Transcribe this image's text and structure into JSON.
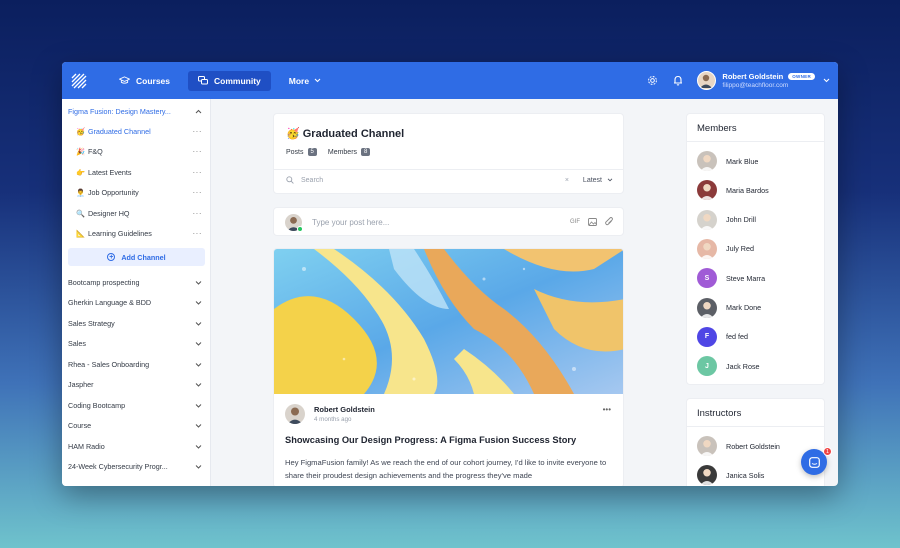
{
  "topbar": {
    "nav": [
      {
        "label": "Courses",
        "icon": "graduation-cap-icon"
      },
      {
        "label": "Community",
        "icon": "chat-bubbles-icon"
      },
      {
        "label": "More",
        "icon": "chevron-down-icon"
      }
    ],
    "user": {
      "name": "Robert Goldstein",
      "badge": "OWNER",
      "email": "filippo@teachfloor.com"
    },
    "accent": "#2f6ce5"
  },
  "sidebar": {
    "course": "Figma Fusion: Design Mastery...",
    "channels": [
      {
        "emoji": "🥳",
        "label": "Graduated Channel"
      },
      {
        "emoji": "🎉",
        "label": "F&Q"
      },
      {
        "emoji": "👉",
        "label": "Latest Events"
      },
      {
        "emoji": "👨‍💼",
        "label": "Job Opportunity"
      },
      {
        "emoji": "🔍",
        "label": "Designer HQ"
      },
      {
        "emoji": "📐",
        "label": "Learning Guidelines"
      }
    ],
    "add_channel": "Add Channel",
    "groups": [
      "Bootcamp prospecting",
      "Gherkin Language & BDD",
      "Sales Strategy",
      "Sales",
      "Rhea - Sales Onboarding",
      "Jaspher",
      "Coding Bootcamp",
      "Course",
      "HAM Radio",
      "24-Week Cybersecurity Progr..."
    ]
  },
  "channel": {
    "title": "🥳 Graduated Channel",
    "posts_label": "Posts",
    "posts_count": "5",
    "members_label": "Members",
    "members_count": "8",
    "search_placeholder": "Search",
    "sort": "Latest"
  },
  "composer": {
    "placeholder": "Type your post here..."
  },
  "post": {
    "author": "Robert Goldstein",
    "time": "4 months ago",
    "title": "Showcasing Our Design Progress: A Figma Fusion Success Story",
    "body": "Hey FigmaFusion family! As we reach the end of our cohort journey, I'd like to invite everyone to share their proudest design achievements and the progress they've made"
  },
  "members_panel": {
    "title": "Members",
    "members": [
      {
        "name": "Mark Blue",
        "initial": "",
        "color": "#c9c2bb"
      },
      {
        "name": "Maria Bardos",
        "initial": "",
        "color": "#8b3a3a"
      },
      {
        "name": "John Drill",
        "initial": "",
        "color": "#d5d2cc"
      },
      {
        "name": "July Red",
        "initial": "",
        "color": "#e6b8a6"
      },
      {
        "name": "Steve Marra",
        "initial": "S",
        "color": "#a05bd6"
      },
      {
        "name": "Mark Done",
        "initial": "",
        "color": "#5c5f66"
      },
      {
        "name": "fed fed",
        "initial": "F",
        "color": "#4f46e5"
      },
      {
        "name": "Jack Rose",
        "initial": "J",
        "color": "#6cc7a3"
      }
    ]
  },
  "instructors_panel": {
    "title": "Instructors",
    "members": [
      {
        "name": "Robert Goldstein",
        "color": "#c9c2bb"
      },
      {
        "name": "Janica Solis",
        "color": "#3a3a3a"
      }
    ]
  },
  "chat": {
    "badge": "1"
  }
}
